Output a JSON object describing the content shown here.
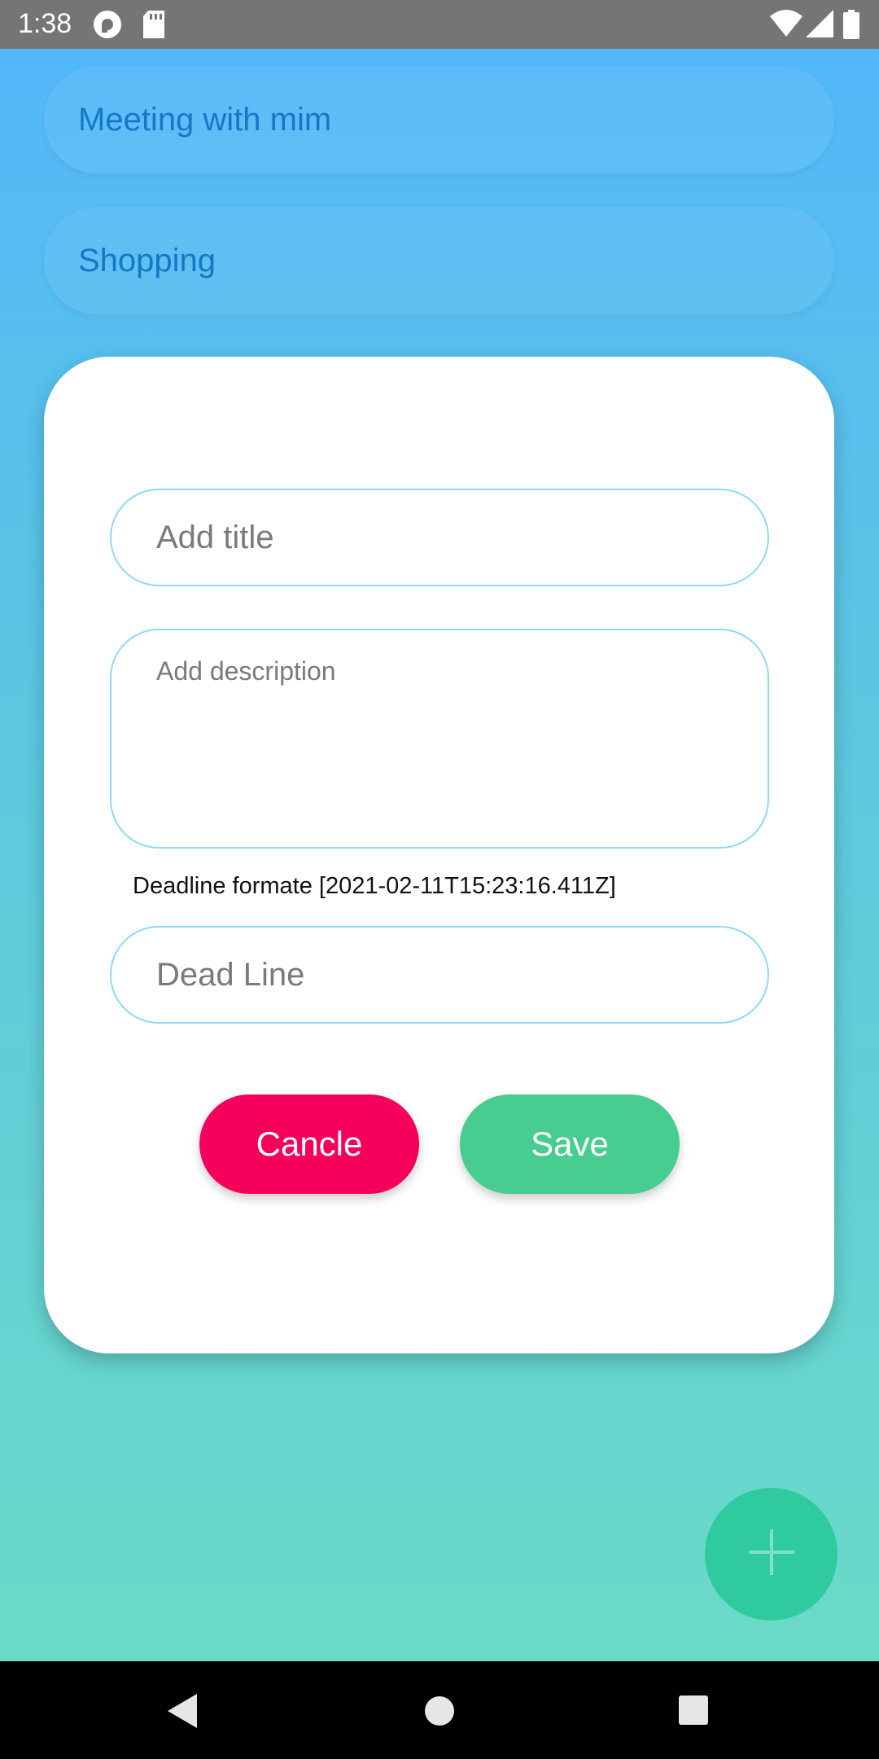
{
  "status": {
    "time": "1:38",
    "icons": [
      "pocket-casts-icon",
      "sd-card-icon",
      "wifi-icon",
      "signal-icon",
      "battery-icon"
    ]
  },
  "todos": [
    {
      "title": "Meeting with mim"
    },
    {
      "title": "Shopping"
    }
  ],
  "dialog": {
    "title_placeholder": "Add title",
    "description_placeholder": "Add description",
    "deadline_hint": "Deadline formate [2021-02-11T15:23:16.411Z]",
    "deadline_placeholder": "Dead Line",
    "cancel_label": "Cancle",
    "save_label": "Save"
  },
  "fab": {
    "icon": "plus-icon"
  },
  "navigation": {
    "icons": [
      "back-icon",
      "home-icon",
      "recents-icon"
    ]
  },
  "colors": {
    "cancel": "#f5005a",
    "save": "#48cd90",
    "fab": "#2fcb9f",
    "field_border": "#8fd9f5"
  }
}
